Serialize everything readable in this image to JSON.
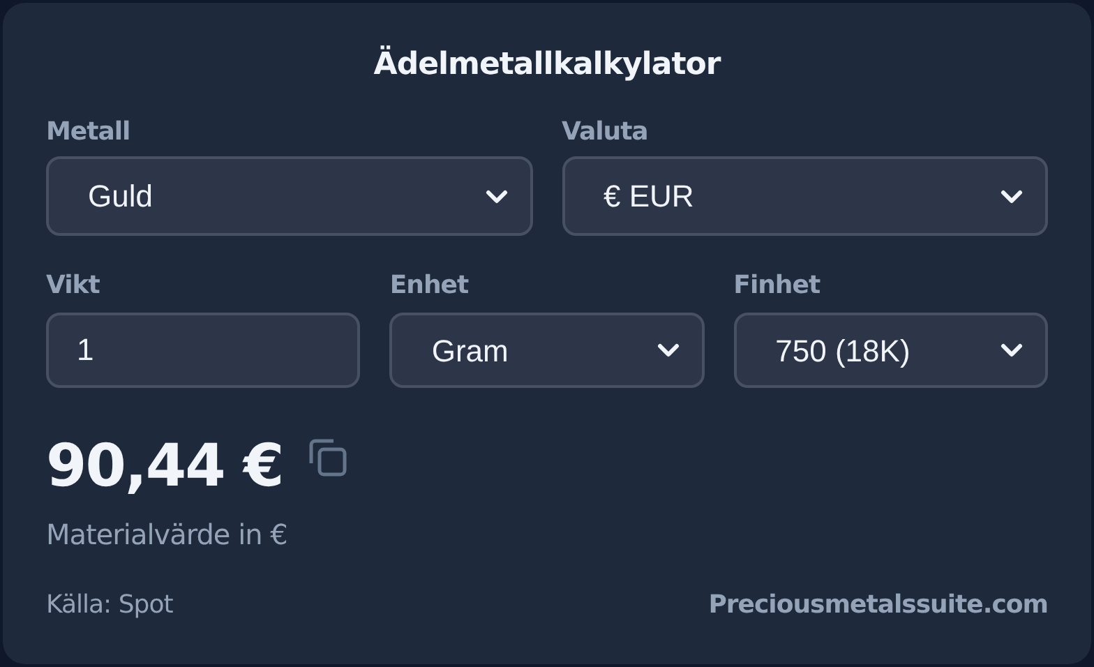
{
  "title": "Ädelmetallkalkylator",
  "row1": [
    {
      "label": "Metall",
      "kind": "select",
      "value": "Guld"
    },
    {
      "label": "Valuta",
      "kind": "select",
      "value": "€ EUR"
    }
  ],
  "row2": [
    {
      "label": "Vikt",
      "kind": "input",
      "value": "1"
    },
    {
      "label": "Enhet",
      "kind": "select",
      "value": "Gram"
    },
    {
      "label": "Finhet",
      "kind": "select",
      "value": "750 (18K)"
    }
  ],
  "result": {
    "value": "90,44 €",
    "caption": "Materialvärde in €"
  },
  "footer": {
    "source": "Källa: Spot",
    "link": "Preciousmetalssuite.com"
  }
}
